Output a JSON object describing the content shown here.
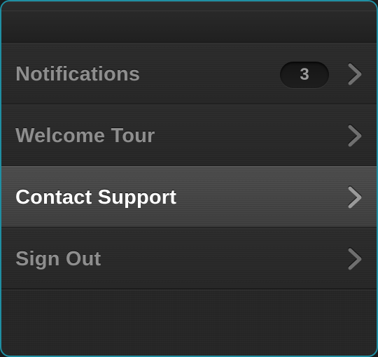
{
  "menu": {
    "items": [
      {
        "label": "Notifications",
        "badge": "3",
        "active": false
      },
      {
        "label": "Welcome Tour",
        "badge": null,
        "active": false
      },
      {
        "label": "Contact Support",
        "badge": null,
        "active": true
      },
      {
        "label": "Sign Out",
        "badge": null,
        "active": false
      }
    ]
  },
  "icons": {
    "chevron": "chevron-right-icon"
  },
  "colors": {
    "frame_border": "#1f8fa3",
    "background": "#262626",
    "active_row": "#444444",
    "label_inactive": "#8e8e8e",
    "label_active": "#ffffff"
  }
}
